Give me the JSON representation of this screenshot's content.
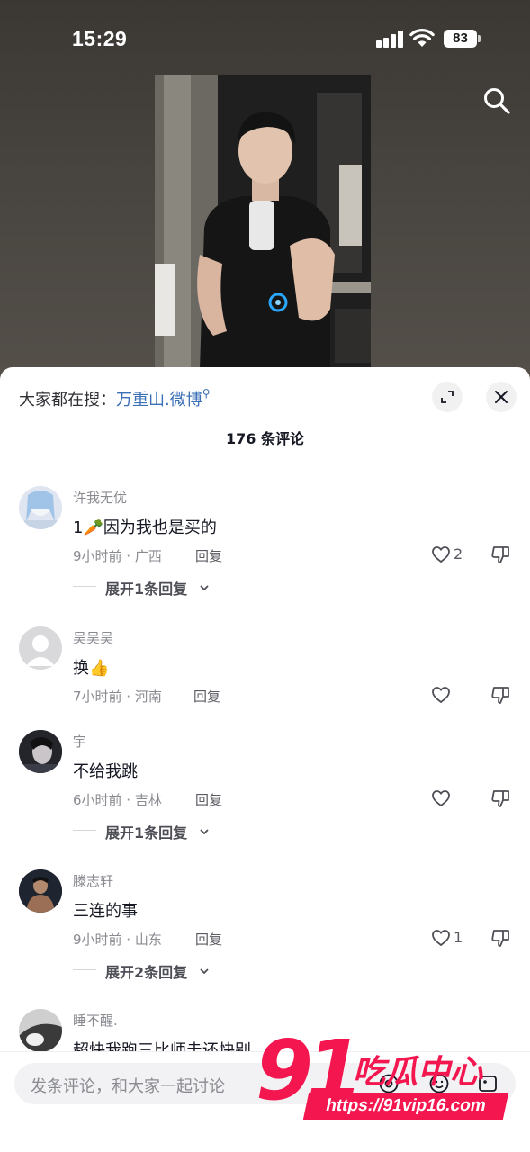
{
  "status_bar": {
    "time": "15:29",
    "battery": "83"
  },
  "video": {
    "search_icon": "search-icon"
  },
  "comments_panel": {
    "hot_search_prefix": "大家都在搜：",
    "hot_search_link": "万重山.微博",
    "title": "176 条评论",
    "comments": [
      {
        "user": "许我无优",
        "text": "1🥕因为我也是买的",
        "meta": "9小时前 · 广西",
        "reply_label": "回复",
        "like_count": "2",
        "expand_label": "展开1条回复"
      },
      {
        "user": "吴吴吴",
        "text": "换👍",
        "meta": "7小时前 · 河南",
        "reply_label": "回复",
        "like_count": ""
      },
      {
        "user": "宇",
        "text": "不给我跳",
        "meta": "6小时前 · 吉林",
        "reply_label": "回复",
        "like_count": "",
        "expand_label": "展开1条回复"
      },
      {
        "user": "滕志轩",
        "text": "三连的事",
        "meta": "9小时前 · 山东",
        "reply_label": "回复",
        "like_count": "1",
        "expand_label": "展开2条回复"
      },
      {
        "user": "睡不醒.",
        "text": "超快我跑三比师圭还快别"
      }
    ]
  },
  "input_bar": {
    "placeholder": "发条评论，和大家一起讨论"
  },
  "watermark": {
    "number": "91",
    "brand": "吃瓜中心",
    "url": "https://91vip16.com"
  },
  "colors": {
    "accent_link": "#3b6fb6",
    "watermark": "#f3164f",
    "sheet_bg": "#ffffff",
    "meta_gray": "#8a8b91"
  }
}
